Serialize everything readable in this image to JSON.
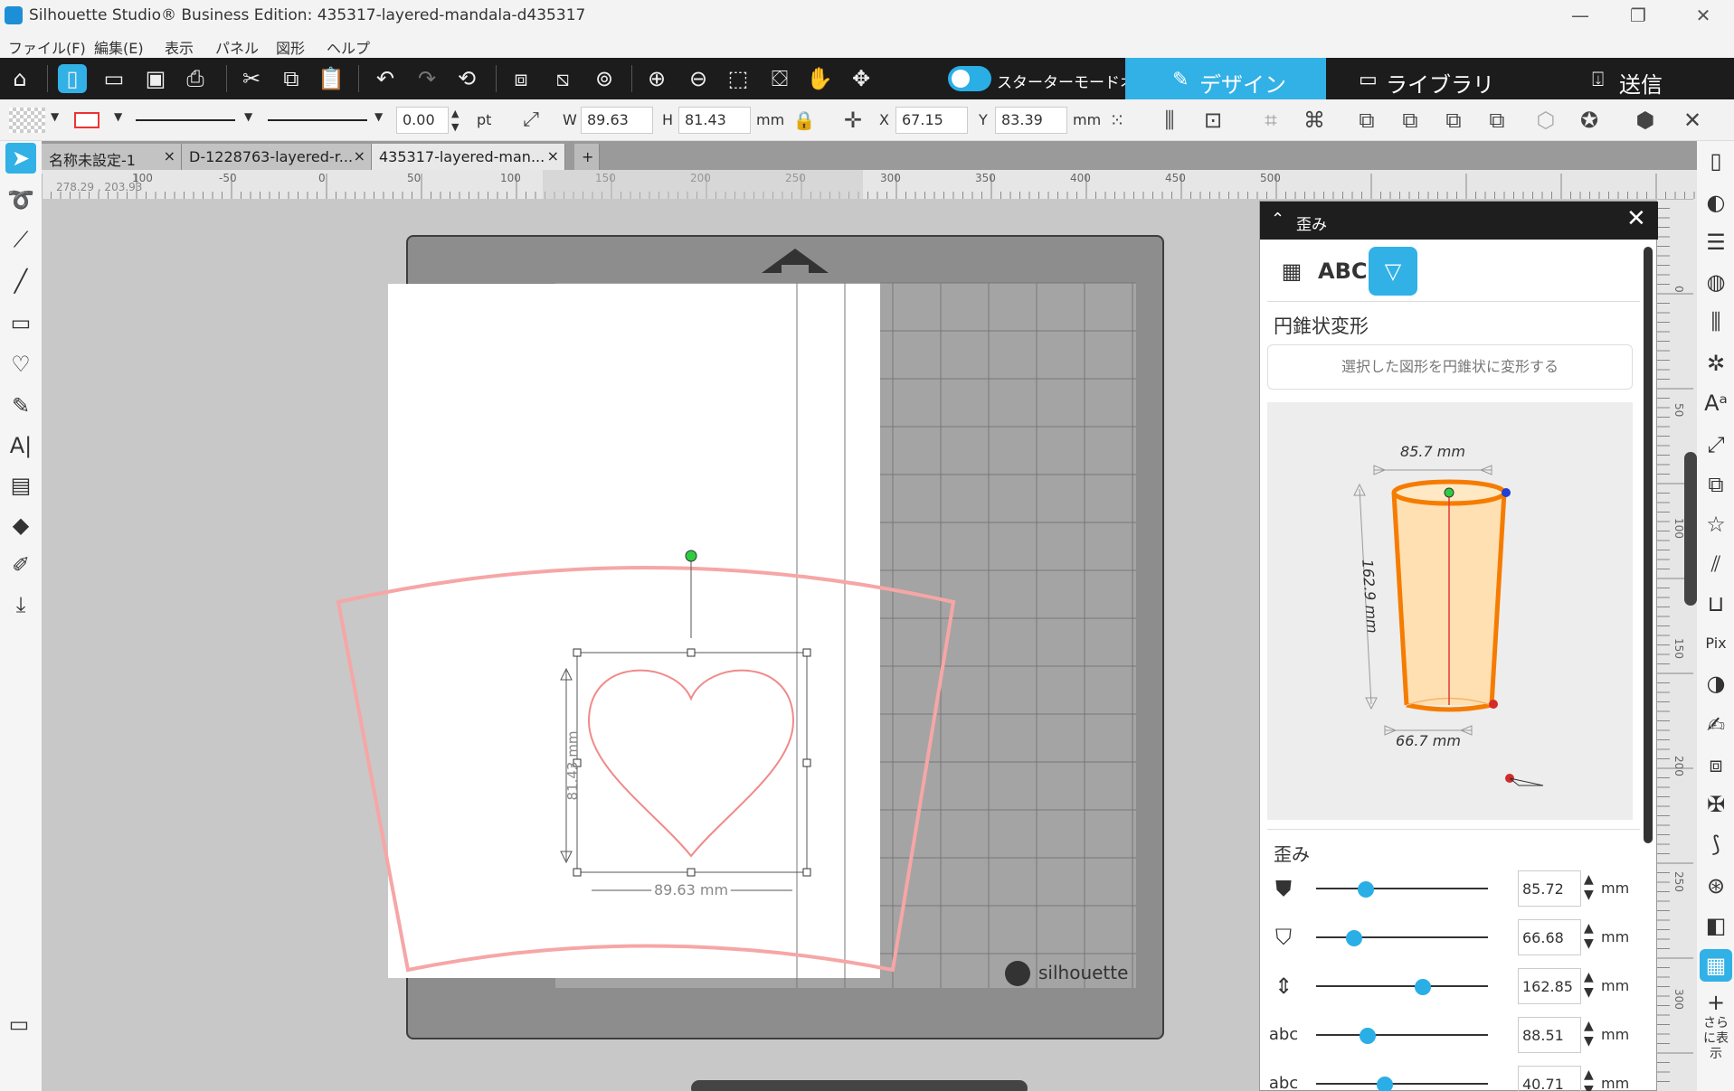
{
  "window": {
    "title": "Silhouette Studio® Business Edition: 435317-layered-mandala-d435317",
    "minimize": "—",
    "restore": "❐",
    "close": "✕"
  },
  "menu": [
    "ファイル(F)",
    "編集(E)",
    "表示",
    "パネル",
    "図形",
    "ヘルプ"
  ],
  "toolbar": {
    "starter_mode_label": "スターターモードオフ",
    "nav_tabs": [
      {
        "label": "デザイン",
        "icon": "design-icon"
      },
      {
        "label": "ライブラリ",
        "icon": "folder-icon"
      },
      {
        "label": "送信",
        "icon": "send-icon"
      }
    ]
  },
  "props": {
    "stroke_width": "0.00",
    "stroke_unit": "pt",
    "w_label": "W",
    "w_value": "89.63",
    "h_label": "H",
    "h_value": "81.43",
    "size_unit": "mm",
    "x_label": "X",
    "x_value": "67.15",
    "y_label": "Y",
    "y_value": "83.39",
    "pos_unit": "mm"
  },
  "doc_tabs": [
    {
      "label": "名称未設定-1",
      "close": "×"
    },
    {
      "label": "D-1228763-layered-r...",
      "close": "×"
    },
    {
      "label": "435317-layered-man...",
      "close": "×"
    }
  ],
  "doc_tab_add": "+",
  "ruler": {
    "coord_readout": "278.29 , 203.93",
    "top_ticks": [
      "100",
      "-50",
      "0",
      "50",
      "100",
      "150",
      "200",
      "250",
      "300",
      "350",
      "400",
      "450",
      "500"
    ],
    "right_ticks": [
      "0",
      "50",
      "100",
      "150",
      "200",
      "250",
      "300"
    ]
  },
  "canvas": {
    "heart_height_label": "81.43 mm",
    "heart_width_label": "89.63 mm",
    "mat_brand": "silhouette",
    "colors": {
      "heart": "#f08a8a",
      "cone_outline": "#f6a6a6",
      "accent": "#31b1e6"
    }
  },
  "panel": {
    "title": "歪み",
    "close": "✕",
    "section_title": "円錐状変形",
    "cone_button": "選択した図形を円錐状に変形する",
    "preview": {
      "top_width": "85.7 mm",
      "height": "162.9 mm",
      "bottom_width": "66.7 mm"
    },
    "distort_label": "歪み",
    "sliders": [
      {
        "icon": "cup-top-width-icon",
        "value": "85.72",
        "unit": "mm",
        "fraction": 0.29
      },
      {
        "icon": "cup-bottom-width-icon",
        "value": "66.68",
        "unit": "mm",
        "fraction": 0.22
      },
      {
        "icon": "cup-height-icon",
        "value": "162.85",
        "unit": "mm",
        "fraction": 0.62
      },
      {
        "icon": "text-arc-icon",
        "value": "88.51",
        "unit": "mm",
        "fraction": 0.3
      },
      {
        "icon": "text-arc-up-icon",
        "value": "40.71",
        "unit": "mm",
        "fraction": 0.4
      }
    ]
  },
  "right_rail_more": "さらに表示"
}
